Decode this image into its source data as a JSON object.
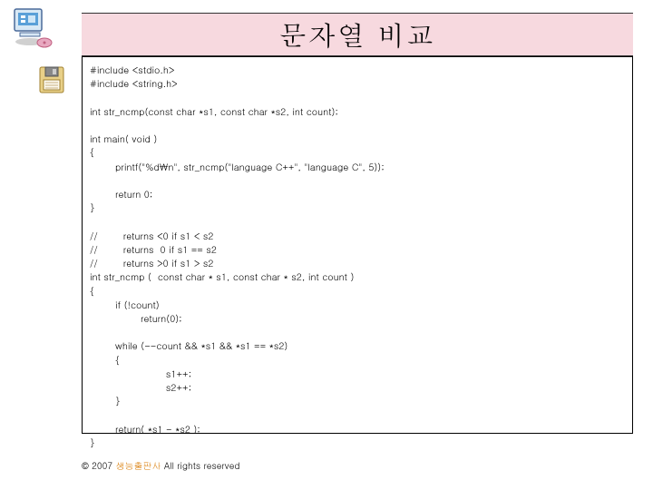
{
  "title": "문자열 비교",
  "code": "#include <stdio.h>\n#include <string.h>\n\nint str_ncmp(const char *s1, const char *s2, int count);\n\nint main( void )\n{\n        printf(\"%d\\n\", str_ncmp(\"language C++\", \"language C\", 5));\n\n        return 0;\n}\n\n//        returns <0 if s1 < s2\n//        returns  0 if s1 == s2\n//        returns >0 if s1 > s2\nint str_ncmp (  const char * s1, const char * s2, int count )\n{\n        if (!count)\n                return(0);\n\n        while (--count && *s1 && *s1 == *s2)\n        {\n                        s1++;\n                        s2++;\n        }\n\n        return( *s1 - *s2 );\n}",
  "footer_prefix": "© 2007 ",
  "footer_orange": "생능출판사",
  "footer_suffix": "  All rights reserved"
}
